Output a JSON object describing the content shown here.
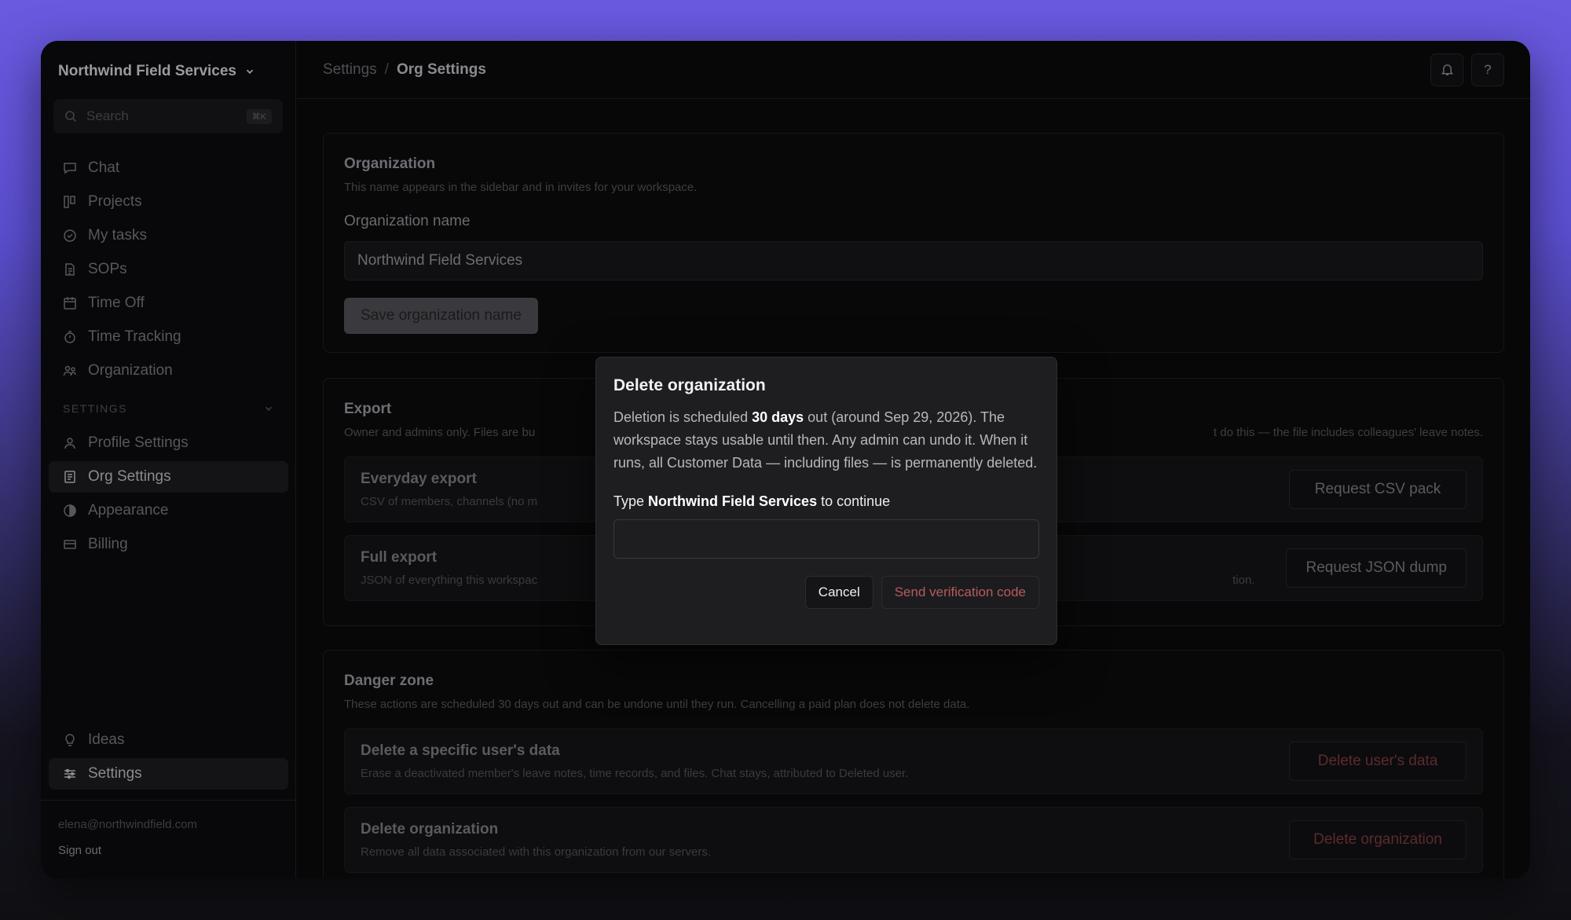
{
  "sidebar": {
    "org_name": "Northwind Field Services",
    "search_placeholder": "Search",
    "search_shortcut": "⌘K",
    "nav": [
      {
        "label": "Chat",
        "icon": "chat-icon"
      },
      {
        "label": "Projects",
        "icon": "kanban-icon"
      },
      {
        "label": "My tasks",
        "icon": "check-circle-icon"
      },
      {
        "label": "SOPs",
        "icon": "document-icon"
      },
      {
        "label": "Time Off",
        "icon": "calendar-icon"
      },
      {
        "label": "Time Tracking",
        "icon": "stopwatch-icon"
      },
      {
        "label": "Organization",
        "icon": "users-icon"
      }
    ],
    "settings_section_label": "SETTINGS",
    "settings_nav": [
      {
        "label": "Profile Settings",
        "icon": "user-icon"
      },
      {
        "label": "Org Settings",
        "icon": "list-document-icon",
        "active": true
      },
      {
        "label": "Appearance",
        "icon": "contrast-icon"
      },
      {
        "label": "Billing",
        "icon": "card-icon"
      }
    ],
    "bottom_nav": [
      {
        "label": "Ideas",
        "icon": "lightbulb-icon"
      },
      {
        "label": "Settings",
        "icon": "sliders-icon",
        "active": true
      }
    ],
    "email": "elena@northwindfield.com",
    "sign_out": "Sign out"
  },
  "header": {
    "breadcrumb_root": "Settings",
    "breadcrumb_sep": "/",
    "breadcrumb_current": "Org Settings",
    "help_label": "?"
  },
  "organization": {
    "title": "Organization",
    "description": "This name appears in the sidebar and in invites for your workspace.",
    "field_label": "Organization name",
    "field_value": "Northwind Field Services",
    "save_label": "Save organization name"
  },
  "export": {
    "title": "Export",
    "description_left": "Owner and admins only. Files are bu",
    "description_right": "t do this — the file includes colleagues' leave notes.",
    "rows": [
      {
        "title": "Everyday export",
        "desc_left": "CSV of members, channels (no m",
        "desc_right": "",
        "button": "Request CSV pack"
      },
      {
        "title": "Full export",
        "desc_left": "JSON of everything this workspac",
        "desc_right": "tion.",
        "button": "Request JSON dump"
      }
    ]
  },
  "danger": {
    "title": "Danger zone",
    "description": "These actions are scheduled 30 days out and can be undone until they run. Cancelling a paid plan does not delete data.",
    "rows": [
      {
        "title": "Delete a specific user's data",
        "desc": "Erase a deactivated member's leave notes, time records, and files. Chat stays, attributed to Deleted user.",
        "button": "Delete user's data"
      },
      {
        "title": "Delete organization",
        "desc": "Remove all data associated with this organization from our servers.",
        "button": "Delete organization"
      }
    ]
  },
  "modal": {
    "title": "Delete organization",
    "body_pre": "Deletion is scheduled ",
    "body_bold": "30 days",
    "body_post": " out (around Sep 29, 2026). The workspace stays usable until then. Any admin can undo it. When it runs, all Customer Data — including files — is permanently deleted.",
    "confirm_pre": "Type ",
    "confirm_name": "Northwind Field Services",
    "confirm_post": " to continue",
    "input_value": "",
    "cancel_label": "Cancel",
    "submit_label": "Send verification code"
  }
}
